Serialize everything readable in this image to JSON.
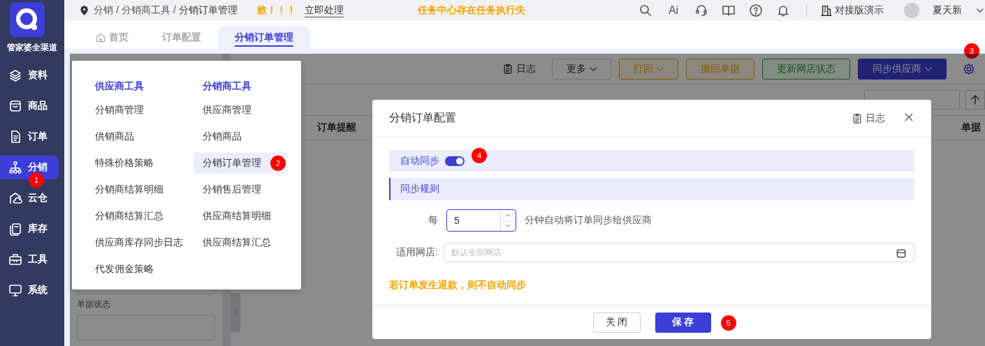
{
  "app": {
    "name": "管家婆全渠道"
  },
  "sidebar": {
    "items": [
      {
        "label": "资料",
        "kind": "layers",
        "selected": false
      },
      {
        "label": "商品",
        "kind": "goods",
        "selected": false
      },
      {
        "label": "订单",
        "kind": "doc",
        "selected": false
      },
      {
        "label": "分销",
        "kind": "tree",
        "selected": true,
        "badge": "1"
      },
      {
        "label": "云仓",
        "kind": "cloud",
        "selected": false
      },
      {
        "label": "库存",
        "kind": "stock",
        "selected": false
      },
      {
        "label": "工具",
        "kind": "toolbox",
        "selected": false
      },
      {
        "label": "系统",
        "kind": "monitor",
        "selected": false
      }
    ]
  },
  "topbar": {
    "breadcrumb": {
      "items": [
        "分销",
        "分销商工具",
        "分销订单管理"
      ],
      "separator": "/"
    },
    "notice": {
      "text": "败！！！",
      "action": "立即处理"
    },
    "task_message": "任务中心存在任务执行失",
    "tools": [
      {
        "kind": "search"
      },
      {
        "kind": "ai",
        "label": "Ai"
      },
      {
        "kind": "headset"
      },
      {
        "kind": "book"
      },
      {
        "kind": "help"
      },
      {
        "kind": "bell"
      }
    ],
    "org": "对接版演示",
    "user": "夏天新"
  },
  "tabs": [
    {
      "label": "首页",
      "kind": "home",
      "selected": false
    },
    {
      "label": "订单配置",
      "kind": "plain",
      "selected": false
    },
    {
      "label": "分销订单管理",
      "kind": "plain",
      "selected": true
    }
  ],
  "toolbar": {
    "log": "日志",
    "buttons": [
      {
        "label": "更多",
        "kind": "default",
        "dropdown": true
      },
      {
        "label": "打回",
        "kind": "warning",
        "dropdown": true
      },
      {
        "label": "撤回单据",
        "kind": "warning",
        "dropdown": false
      },
      {
        "label": "更新网店状态",
        "kind": "success",
        "dropdown": false
      },
      {
        "label": "同步供应商",
        "kind": "primary",
        "dropdown": true
      }
    ],
    "settings_badge": "3"
  },
  "table": {
    "columns": [
      "订单提醒",
      "单据"
    ]
  },
  "filter_panel": {
    "fields": [
      {
        "label": "单据状态"
      }
    ]
  },
  "menu": {
    "columns": [
      {
        "heading": "供应商工具",
        "items": [
          {
            "label": "分销商管理",
            "selected": false
          },
          {
            "label": "供销商品",
            "selected": false
          },
          {
            "label": "特殊价格策略",
            "selected": false
          },
          {
            "label": "分销商结算明细",
            "selected": false
          },
          {
            "label": "分销商结算汇总",
            "selected": false
          },
          {
            "label": "供应商库存同步日志",
            "selected": false
          },
          {
            "label": "代发佣金策略",
            "selected": false
          }
        ]
      },
      {
        "heading": "分销商工具",
        "items": [
          {
            "label": "供应商管理",
            "selected": false
          },
          {
            "label": "分销商品",
            "selected": false
          },
          {
            "label": "分销订单管理",
            "selected": true,
            "badge": "2"
          },
          {
            "label": "分销售后管理",
            "selected": false
          },
          {
            "label": "供应商结算明细",
            "selected": false
          },
          {
            "label": "供应商结算汇总",
            "selected": false
          }
        ]
      }
    ]
  },
  "dialog": {
    "title": "分销订单配置",
    "log": "日志",
    "auto_sync": {
      "label": "自动同步",
      "on": true,
      "badge": "4"
    },
    "section": "同步规则",
    "interval": {
      "prefix": "每",
      "value": "5",
      "suffix": "分钟自动将订单同步给供应商"
    },
    "shops": {
      "label": "适用网店:",
      "placeholder": "默认全部网店"
    },
    "warning": "若订单发生退款，则不自动同步",
    "buttons": [
      {
        "label": "关 闭",
        "kind": "default"
      },
      {
        "label": "保 存",
        "kind": "primary",
        "badge": "5"
      }
    ]
  }
}
